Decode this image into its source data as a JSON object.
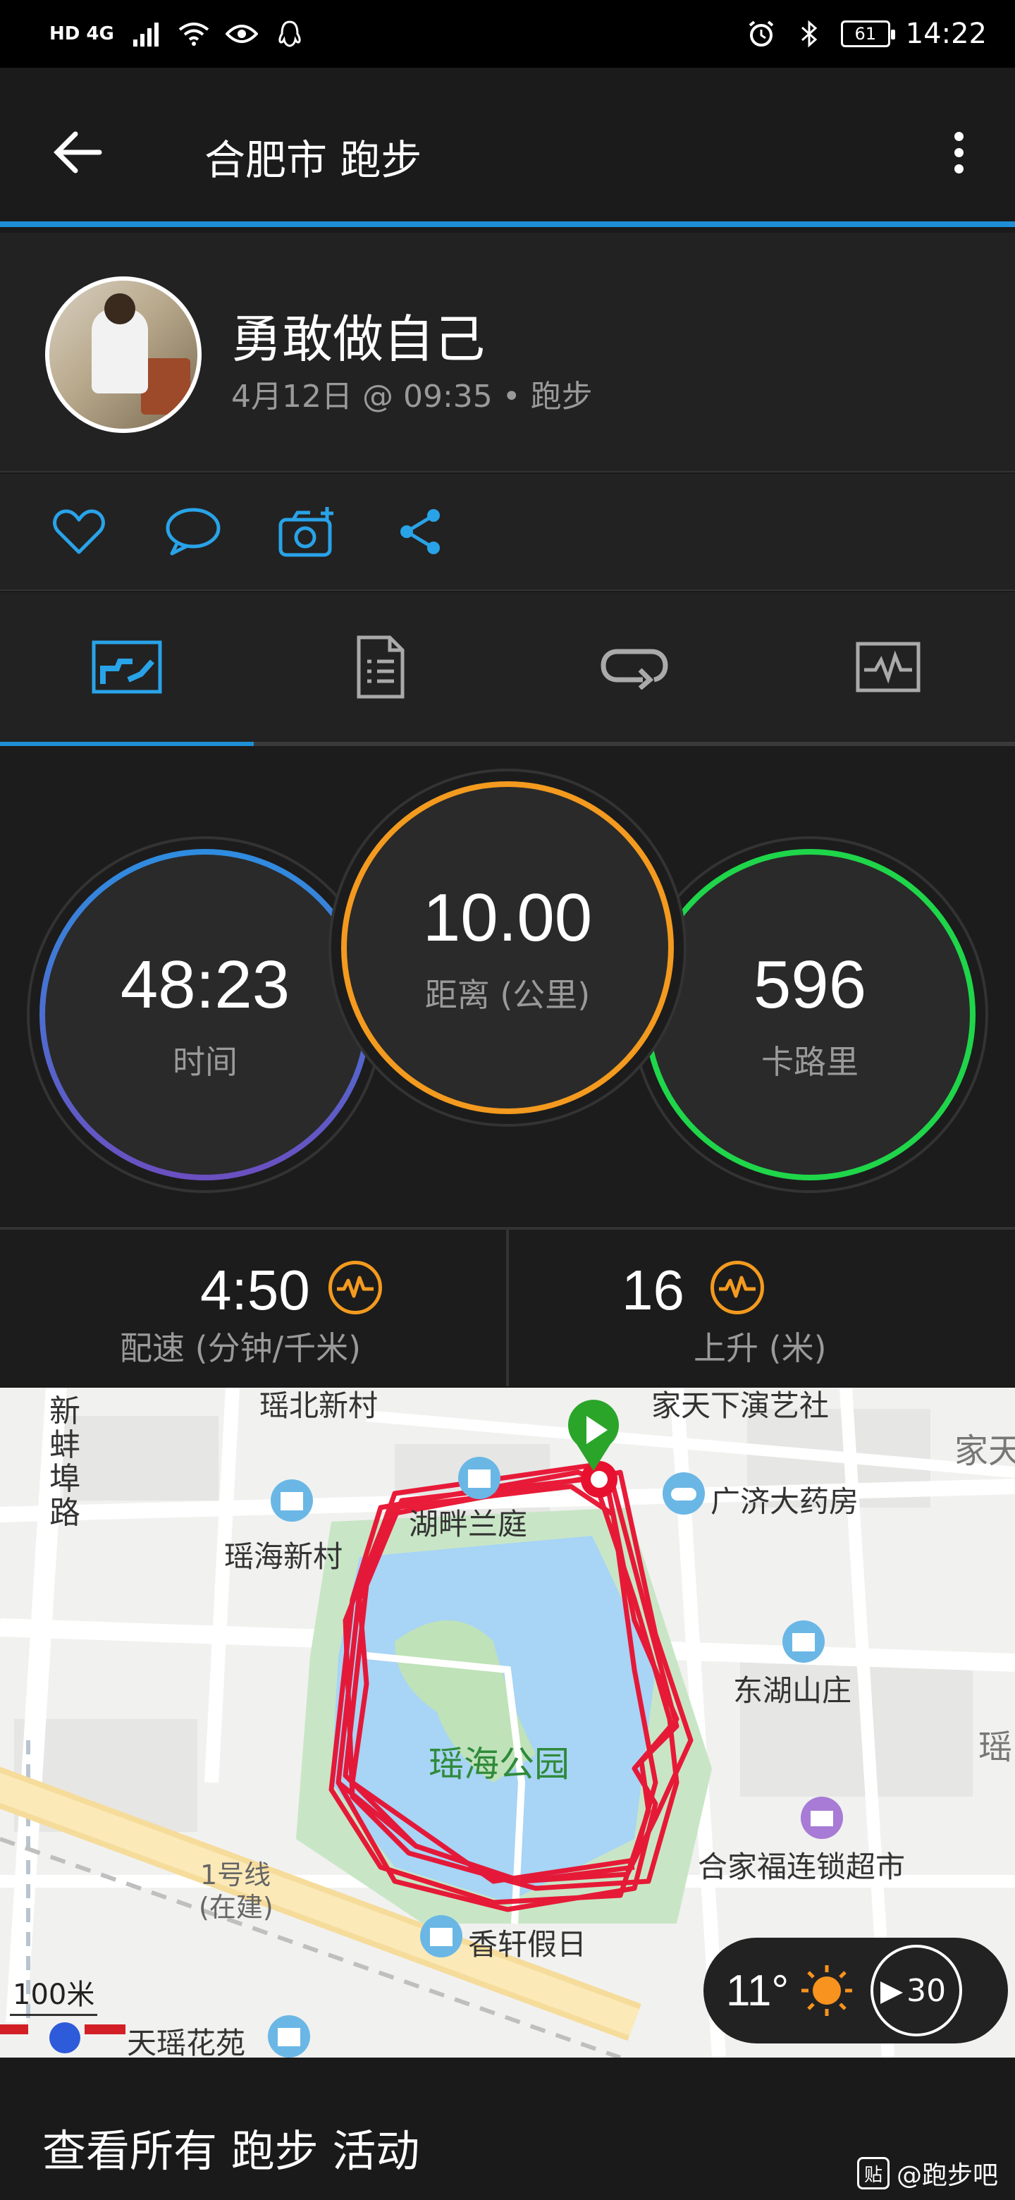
{
  "status_bar": {
    "left_text": "HD 4G",
    "battery": "61",
    "time": "14:22"
  },
  "app_bar": {
    "title": "合肥市 跑步"
  },
  "profile": {
    "name": "勇敢做自己",
    "meta": "4月12日 @ 09:35 • 跑步"
  },
  "stats": {
    "time_value": "48:23",
    "time_label": "时间",
    "distance_value": "10.00",
    "distance_label": "距离 (公里)",
    "calories_value": "596",
    "calories_label": "卡路里",
    "pace_value": "4:50",
    "pace_label": "配速 (分钟/千米)",
    "ascent_value": "16",
    "ascent_label": "上升 (米)"
  },
  "map": {
    "labels": {
      "l1": "瑶北新村",
      "l2": "家天下演艺社",
      "l3": "新蚌埠路",
      "l4": "湖畔兰庭",
      "l5": "广济大药房",
      "l6": "瑶海新村",
      "l7": "东湖山庄",
      "l8": "瑶海公园",
      "l9": "合家福连锁超市",
      "l10": "1号线",
      "l11": "(在建)",
      "l12": "香轩假日",
      "l13": "天瑶花苑",
      "l14": "家天",
      "l15": "瑶"
    },
    "scale": "100米",
    "weather_temp": "11°",
    "wind_speed": "30"
  },
  "footer": {
    "link": "查看所有 跑步 活动",
    "watermark": "@跑步吧",
    "watermark_badge": "贴"
  },
  "colors": {
    "accent": "#1e8fd6",
    "distance_ring": "#f39a1f",
    "calories_ring": "#1fd64a",
    "route": "#e8102f"
  }
}
